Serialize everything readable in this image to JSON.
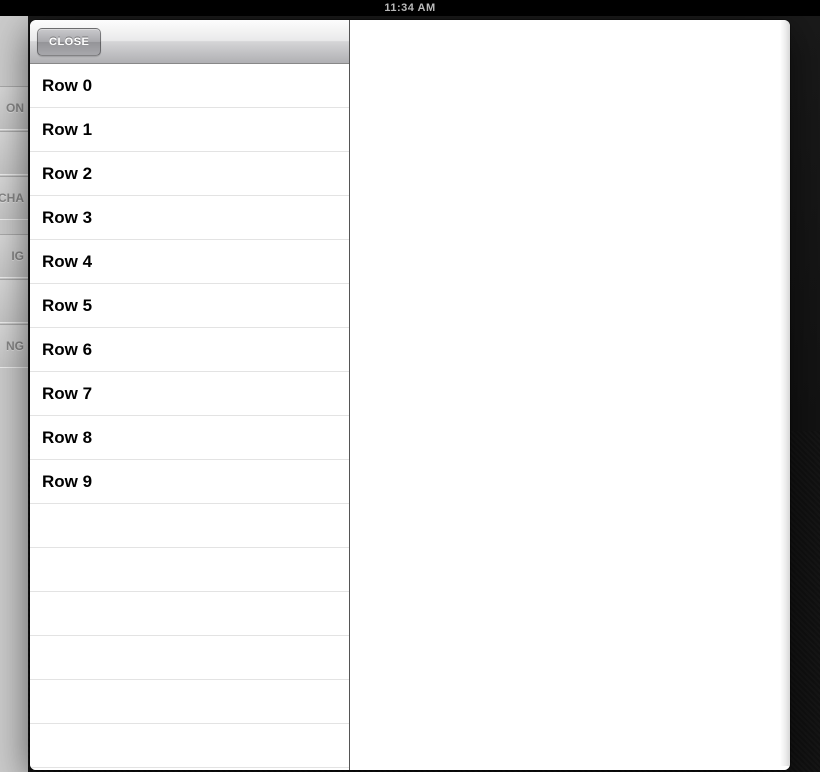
{
  "status": {
    "time": "11:34 AM"
  },
  "background_panel": {
    "items": [
      "ON",
      "",
      "CHA",
      "IG",
      "",
      "NG"
    ]
  },
  "modal": {
    "close_label": "CLOSE",
    "rows": [
      {
        "label": "Row 0"
      },
      {
        "label": "Row 1"
      },
      {
        "label": "Row 2"
      },
      {
        "label": "Row 3"
      },
      {
        "label": "Row 4"
      },
      {
        "label": "Row 5"
      },
      {
        "label": "Row 6"
      },
      {
        "label": "Row 7"
      },
      {
        "label": "Row 8"
      },
      {
        "label": "Row 9"
      }
    ],
    "blank_row_count": 6
  }
}
